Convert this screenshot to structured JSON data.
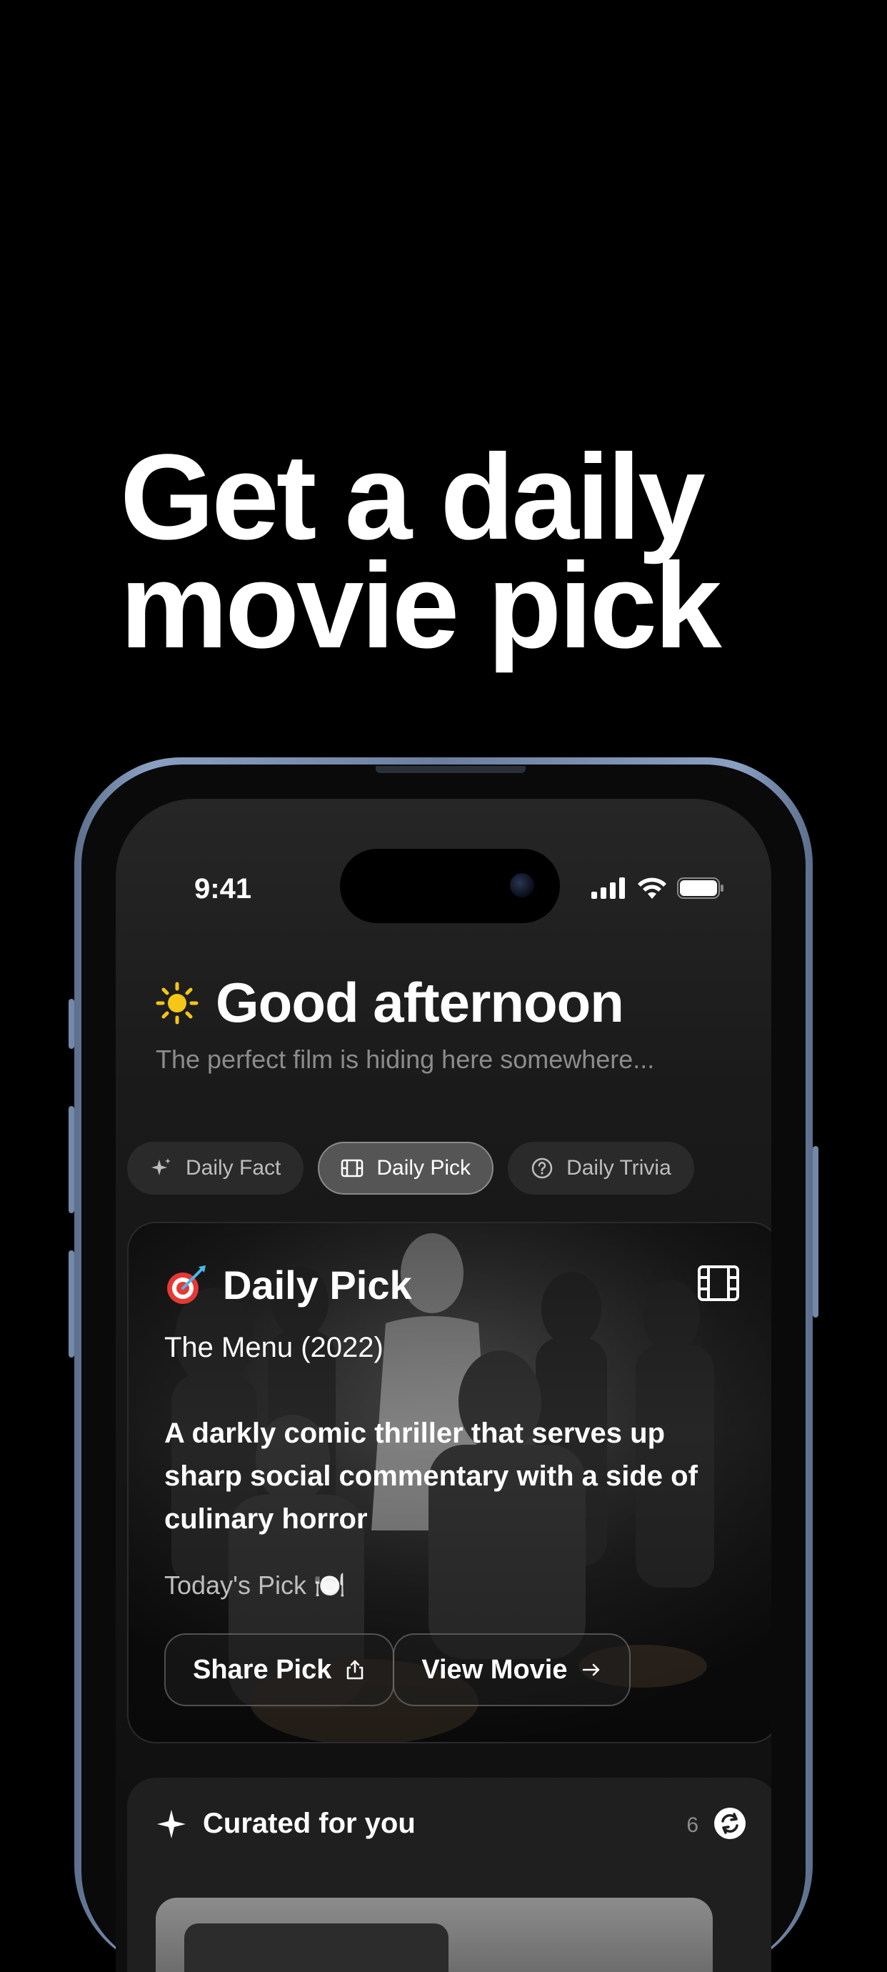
{
  "headline": {
    "line1": "Get a daily",
    "line2": "movie pick"
  },
  "status_bar": {
    "time": "9:41"
  },
  "greeting": {
    "title": "Good afternoon",
    "subtitle": "The perfect film is hiding here somewhere..."
  },
  "tabs": [
    {
      "label": "Daily Fact",
      "icon": "sparkle-icon",
      "active": false
    },
    {
      "label": "Daily Pick",
      "icon": "film-icon",
      "active": true
    },
    {
      "label": "Daily Trivia",
      "icon": "question-circle-icon",
      "active": false
    }
  ],
  "daily_pick": {
    "title": "Daily Pick",
    "movie": "The Menu (2022)",
    "description": "A darkly comic thriller that serves up sharp social commentary with a side of culinary horror",
    "tag": "Today's Pick 🍽️",
    "share_label": "Share Pick",
    "view_label": "View Movie"
  },
  "curated": {
    "title": "Curated for you",
    "count": "6"
  },
  "colors": {
    "background": "#000000",
    "sun": "#f5c518",
    "frame": "#7488a8"
  }
}
